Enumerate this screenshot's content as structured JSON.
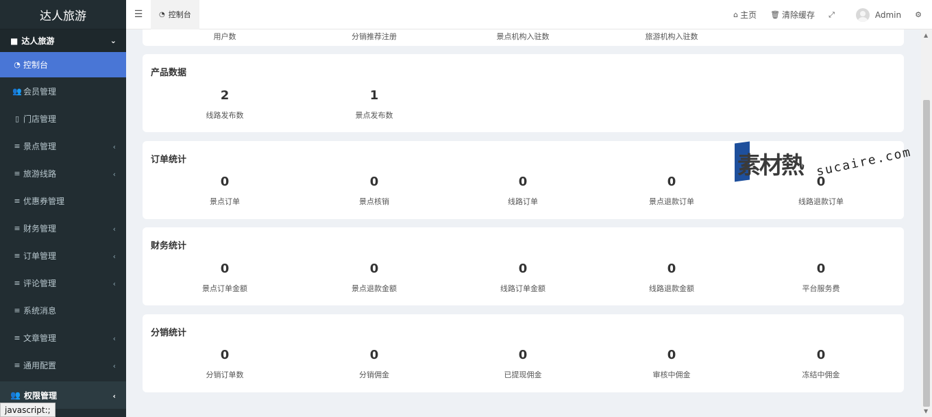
{
  "brand": "达人旅游",
  "sidebar": {
    "group_label": "达人旅游",
    "items": [
      {
        "label": "控制台",
        "icon": "dashboard-icon",
        "active": true
      },
      {
        "label": "会员管理",
        "icon": "users-icon"
      },
      {
        "label": "门店管理",
        "icon": "building-icon"
      },
      {
        "label": "景点管理",
        "icon": "list-icon",
        "has_children": true
      },
      {
        "label": "旅游线路",
        "icon": "list-icon",
        "has_children": true
      },
      {
        "label": "优惠券管理",
        "icon": "list-icon"
      },
      {
        "label": "财务管理",
        "icon": "list-icon",
        "has_children": true
      },
      {
        "label": "订单管理",
        "icon": "list-icon",
        "has_children": true
      },
      {
        "label": "评论管理",
        "icon": "list-icon",
        "has_children": true
      },
      {
        "label": "系统消息",
        "icon": "list-icon"
      },
      {
        "label": "文章管理",
        "icon": "list-icon",
        "has_children": true
      },
      {
        "label": "通用配置",
        "icon": "list-icon",
        "has_children": true
      }
    ],
    "footer_group_label": "权限管理"
  },
  "status_bar": "javascript:;",
  "topbar": {
    "tab_label": "控制台",
    "home_label": "主页",
    "clear_cache_label": "清除缓存",
    "user_name": "Admin"
  },
  "cards": {
    "top_partial": {
      "labels": [
        "用户数",
        "分销推荐注册",
        "景点机构入驻数",
        "旅游机构入驻数"
      ]
    },
    "product": {
      "title": "产品数据",
      "stats": [
        {
          "value": "2",
          "label": "线路发布数"
        },
        {
          "value": "1",
          "label": "景点发布数"
        }
      ]
    },
    "orders": {
      "title": "订单统计",
      "stats": [
        {
          "value": "0",
          "label": "景点订单"
        },
        {
          "value": "0",
          "label": "景点核销"
        },
        {
          "value": "0",
          "label": "线路订单"
        },
        {
          "value": "0",
          "label": "景点退款订单"
        },
        {
          "value": "0",
          "label": "线路退款订单"
        }
      ]
    },
    "finance": {
      "title": "财务统计",
      "stats": [
        {
          "value": "0",
          "label": "景点订单金额"
        },
        {
          "value": "0",
          "label": "景点退款金额"
        },
        {
          "value": "0",
          "label": "线路订单金额"
        },
        {
          "value": "0",
          "label": "线路退款金额"
        },
        {
          "value": "0",
          "label": "平台服务费"
        }
      ]
    },
    "distribution": {
      "title": "分销统计",
      "stats": [
        {
          "value": "0",
          "label": "分销订单数"
        },
        {
          "value": "0",
          "label": "分销佣金"
        },
        {
          "value": "0",
          "label": "已提现佣金"
        },
        {
          "value": "0",
          "label": "审核中佣金"
        },
        {
          "value": "0",
          "label": "冻结中佣金"
        }
      ]
    }
  },
  "watermark": {
    "cn": "素材熱",
    "en": "sucaire.com"
  },
  "colors": {
    "sidebar_bg": "#222d32",
    "active_bg": "#4976d6",
    "page_bg": "#eef1f5"
  }
}
